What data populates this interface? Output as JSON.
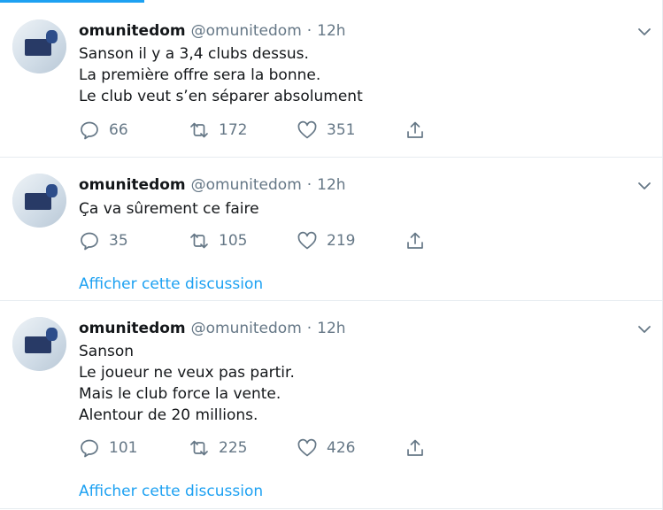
{
  "accent": "#1da1f2",
  "tweets": [
    {
      "name": "omunitedom",
      "handle": "@omunitedom",
      "separator": "·",
      "time": "12h",
      "text": "Sanson il y a 3,4 clubs dessus.\nLa première offre sera la bonne.\nLe club veut s’en séparer absolument",
      "replies": "66",
      "retweets": "172",
      "likes": "351",
      "thread_link": ""
    },
    {
      "name": "omunitedom",
      "handle": "@omunitedom",
      "separator": "·",
      "time": "12h",
      "text": "Ça va sûrement ce faire",
      "replies": "35",
      "retweets": "105",
      "likes": "219",
      "thread_link": "Afficher cette discussion"
    },
    {
      "name": "omunitedom",
      "handle": "@omunitedom",
      "separator": "·",
      "time": "12h",
      "text": "Sanson\nLe joueur ne veux pas partir.\nMais le club force la vente.\nAlentour de 20 millions.",
      "replies": "101",
      "retweets": "225",
      "likes": "426",
      "thread_link": "Afficher cette discussion"
    }
  ]
}
